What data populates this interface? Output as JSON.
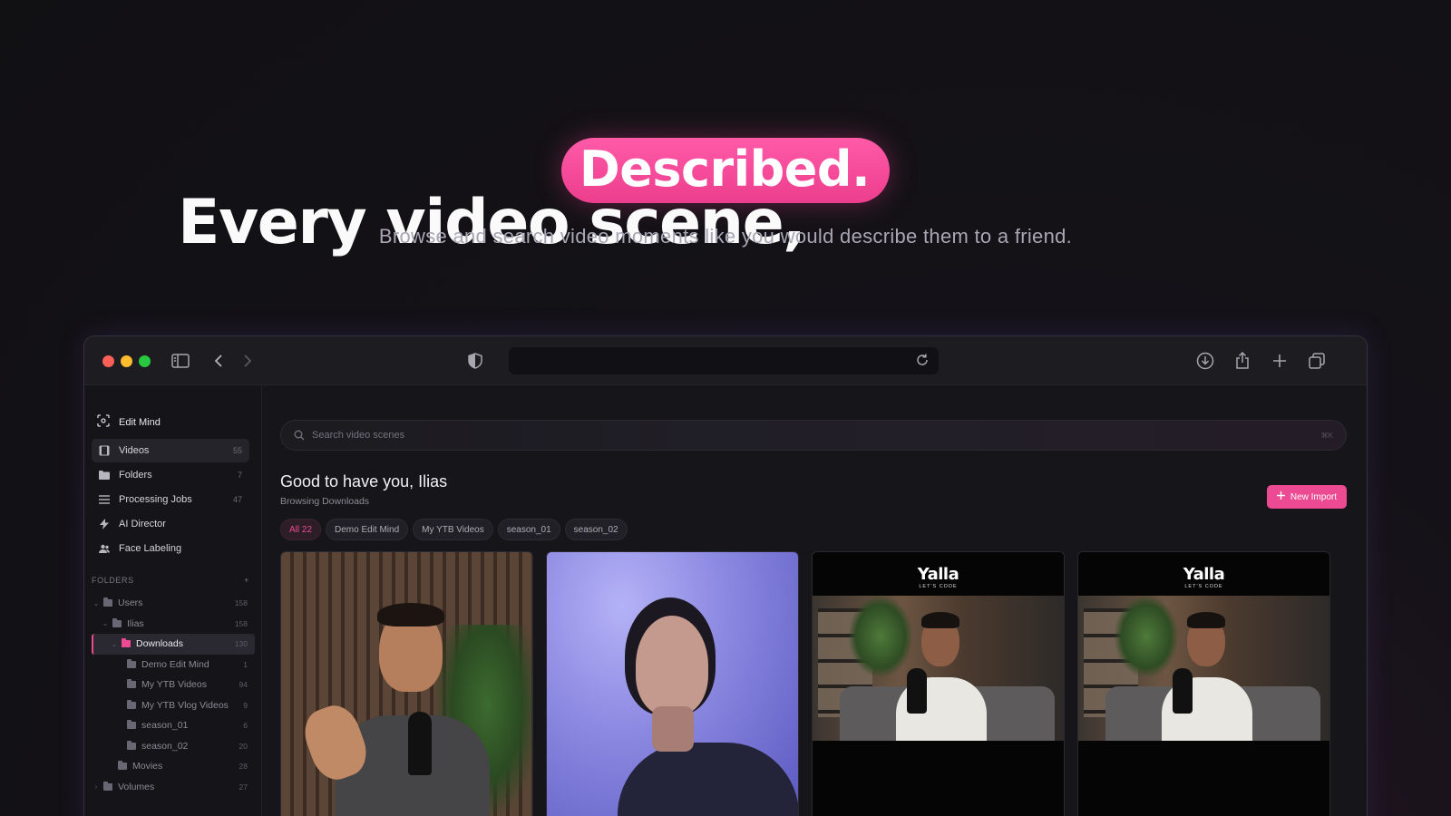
{
  "hero": {
    "title": "Every video scene,",
    "highlight": "Described.",
    "subtitle": "Browse and search video moments like you would describe them to a friend."
  },
  "colors": {
    "accent": "#ec4b93",
    "background": "#111013",
    "traffic_red": "#fe5f57",
    "traffic_yellow": "#febc2e",
    "traffic_green": "#28c840"
  },
  "browser": {
    "icons": [
      "sidebar-toggle-icon",
      "back-icon",
      "forward-icon",
      "shield-icon",
      "reload-icon",
      "download-icon",
      "share-icon",
      "new-tab-icon",
      "tabs-icon"
    ]
  },
  "sidebar": {
    "app_name": "Edit Mind",
    "nav": [
      {
        "label": "Videos",
        "count": "55",
        "icon": "film-icon"
      },
      {
        "label": "Folders",
        "count": "7",
        "icon": "folder-icon"
      },
      {
        "label": "Processing Jobs",
        "count": "47",
        "icon": "list-icon"
      },
      {
        "label": "AI Director",
        "count": "",
        "icon": "bolt-icon"
      },
      {
        "label": "Face Labeling",
        "count": "",
        "icon": "people-icon"
      }
    ],
    "folders_header": "FOLDERS",
    "folders_add": "+",
    "tree": [
      {
        "label": "Users",
        "count": "158"
      },
      {
        "label": "Ilias",
        "count": "158"
      },
      {
        "label": "Downloads",
        "count": "130"
      },
      {
        "label": "Demo Edit Mind",
        "count": "1"
      },
      {
        "label": "My YTB Videos",
        "count": "94"
      },
      {
        "label": "My YTB Vlog Videos",
        "count": "9"
      },
      {
        "label": "season_01",
        "count": "6"
      },
      {
        "label": "season_02",
        "count": "20"
      },
      {
        "label": "Movies",
        "count": "28"
      },
      {
        "label": "Volumes",
        "count": "27"
      }
    ]
  },
  "main": {
    "search_placeholder": "Search video scenes",
    "search_shortcut": "⌘K",
    "greeting": "Good to have you, Ilias",
    "browsing": "Browsing Downloads",
    "new_import": "New Import",
    "chips": [
      "All 22",
      "Demo Edit Mind",
      "My YTB Videos",
      "season_01",
      "season_02"
    ],
    "cards": [
      {
        "type": "video"
      },
      {
        "type": "video"
      },
      {
        "type": "video",
        "brand": "Yalla",
        "brand_sub": "LET'S CODE"
      },
      {
        "type": "video",
        "brand": "Yalla",
        "brand_sub": "LET'S CODE"
      }
    ]
  }
}
